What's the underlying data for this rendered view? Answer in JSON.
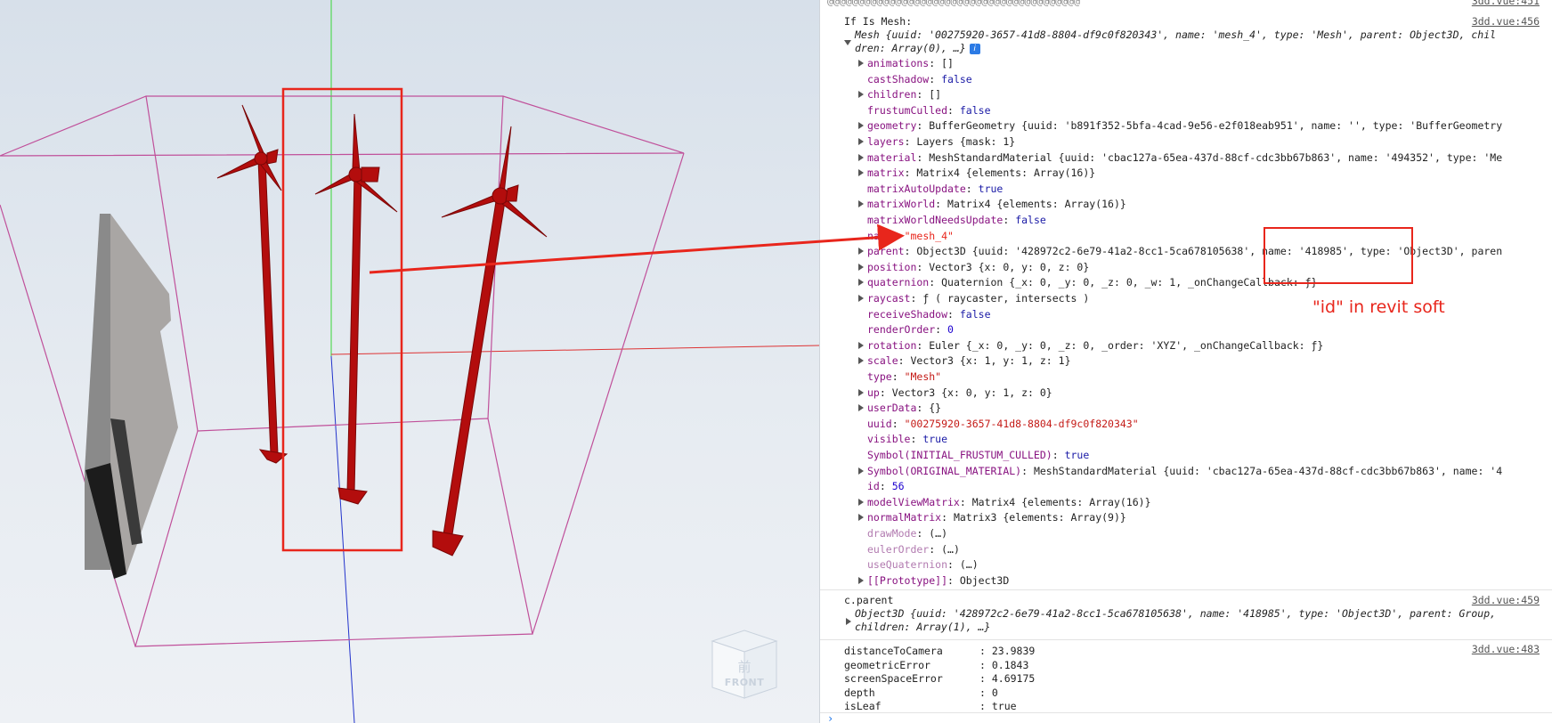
{
  "console": {
    "top_source": "3dd.vue:451",
    "if_is_mesh": "If Is Mesh:",
    "mesh_src": "3dd.vue:456",
    "mesh_summary_1": "Mesh {uuid: '00275920-3657-41d8-8804-df9c0f820343', name: 'mesh_4', type: 'Mesh', parent: Object3D, chil",
    "mesh_summary_2": "dren: Array(0), …}",
    "props": [
      {
        "expand": true,
        "dim": false,
        "key": "animations",
        "value": "[]"
      },
      {
        "expand": false,
        "dim": false,
        "key": "castShadow",
        "value": "false"
      },
      {
        "expand": true,
        "dim": false,
        "key": "children",
        "value": "[]"
      },
      {
        "expand": false,
        "dim": false,
        "key": "frustumCulled",
        "value": "false"
      },
      {
        "expand": true,
        "dim": false,
        "key": "geometry",
        "value": "BufferGeometry {uuid: 'b891f352-5bfa-4cad-9e56-e2f018eab951', name: '', type: 'BufferGeometry"
      },
      {
        "expand": true,
        "dim": false,
        "key": "layers",
        "value": "Layers {mask: 1}"
      },
      {
        "expand": true,
        "dim": false,
        "key": "material",
        "value": "MeshStandardMaterial {uuid: 'cbac127a-65ea-437d-88cf-cdc3bb67b863', name: '494352', type: 'Me"
      },
      {
        "expand": true,
        "dim": false,
        "key": "matrix",
        "value": "Matrix4 {elements: Array(16)}"
      },
      {
        "expand": false,
        "dim": false,
        "key": "matrixAutoUpdate",
        "value": "true"
      },
      {
        "expand": true,
        "dim": false,
        "key": "matrixWorld",
        "value": "Matrix4 {elements: Array(16)}"
      },
      {
        "expand": false,
        "dim": false,
        "key": "matrixWorldNeedsUpdate",
        "value": "false"
      },
      {
        "expand": false,
        "dim": false,
        "key": "name",
        "value": "\"mesh_4\""
      },
      {
        "expand": true,
        "dim": false,
        "key": "parent",
        "value": "Object3D {uuid: '428972c2-6e79-41a2-8cc1-5ca678105638', name: '418985', type: 'Object3D', paren"
      },
      {
        "expand": true,
        "dim": false,
        "key": "position",
        "value": "Vector3 {x: 0, y: 0, z: 0}"
      },
      {
        "expand": true,
        "dim": false,
        "key": "quaternion",
        "value": "Quaternion {_x: 0, _y: 0, _z: 0, _w: 1, _onChangeCallback: ƒ}"
      },
      {
        "expand": true,
        "dim": false,
        "key": "raycast",
        "value": "ƒ ( raycaster, intersects )"
      },
      {
        "expand": false,
        "dim": false,
        "key": "receiveShadow",
        "value": "false"
      },
      {
        "expand": false,
        "dim": false,
        "key": "renderOrder",
        "value": "0"
      },
      {
        "expand": true,
        "dim": false,
        "key": "rotation",
        "value": "Euler {_x: 0, _y: 0, _z: 0, _order: 'XYZ', _onChangeCallback: ƒ}"
      },
      {
        "expand": true,
        "dim": false,
        "key": "scale",
        "value": "Vector3 {x: 1, y: 1, z: 1}"
      },
      {
        "expand": false,
        "dim": false,
        "key": "type",
        "value": "\"Mesh\""
      },
      {
        "expand": true,
        "dim": false,
        "key": "up",
        "value": "Vector3 {x: 0, y: 1, z: 0}"
      },
      {
        "expand": true,
        "dim": false,
        "key": "userData",
        "value": "{}"
      },
      {
        "expand": false,
        "dim": false,
        "key": "uuid",
        "value": "\"00275920-3657-41d8-8804-df9c0f820343\""
      },
      {
        "expand": false,
        "dim": false,
        "key": "visible",
        "value": "true"
      },
      {
        "expand": false,
        "dim": false,
        "key": "Symbol(INITIAL_FRUSTUM_CULLED)",
        "value": "true"
      },
      {
        "expand": true,
        "dim": false,
        "key": "Symbol(ORIGINAL_MATERIAL)",
        "value": "MeshStandardMaterial {uuid: 'cbac127a-65ea-437d-88cf-cdc3bb67b863', name: '4"
      },
      {
        "expand": false,
        "dim": false,
        "key": "id",
        "value": "56"
      },
      {
        "expand": true,
        "dim": false,
        "key": "modelViewMatrix",
        "value": "Matrix4 {elements: Array(16)}"
      },
      {
        "expand": true,
        "dim": false,
        "key": "normalMatrix",
        "value": "Matrix3 {elements: Array(9)}"
      },
      {
        "expand": false,
        "dim": true,
        "key": "drawMode",
        "value": "(…)"
      },
      {
        "expand": false,
        "dim": true,
        "key": "eulerOrder",
        "value": "(…)"
      },
      {
        "expand": false,
        "dim": true,
        "key": "useQuaternion",
        "value": "(…)"
      },
      {
        "expand": true,
        "dim": false,
        "key": "[[Prototype]]",
        "value": "Object3D"
      }
    ],
    "c_parent_label": "c.parent",
    "c_parent_src": "3dd.vue:459",
    "c_parent_summary_1": "Object3D {uuid: '428972c2-6e79-41a2-8cc1-5ca678105638', name: '418985', type: 'Object3D', parent: Group,",
    "c_parent_summary_2": "children: Array(1), …}",
    "metrics_src": "3dd.vue:483",
    "metrics": [
      {
        "label": "distanceToCamera",
        "value": ": 23.9839"
      },
      {
        "label": "geometricError",
        "value": ": 0.1843"
      },
      {
        "label": "screenSpaceError",
        "value": ": 4.69175"
      },
      {
        "label": "depth",
        "value": ": 0"
      },
      {
        "label": "isLeaf",
        "value": ": true"
      }
    ]
  },
  "annotations": {
    "arrow_label": "\"mesh_4\"",
    "revit_note": "\"id\" in revit soft",
    "annotation_color": "#e8261c"
  },
  "viewport": {
    "navcube_label": "FRONT",
    "navcube_face": "前",
    "turbine_color": "#b30d0d",
    "bbox_color": "#c0509a"
  }
}
